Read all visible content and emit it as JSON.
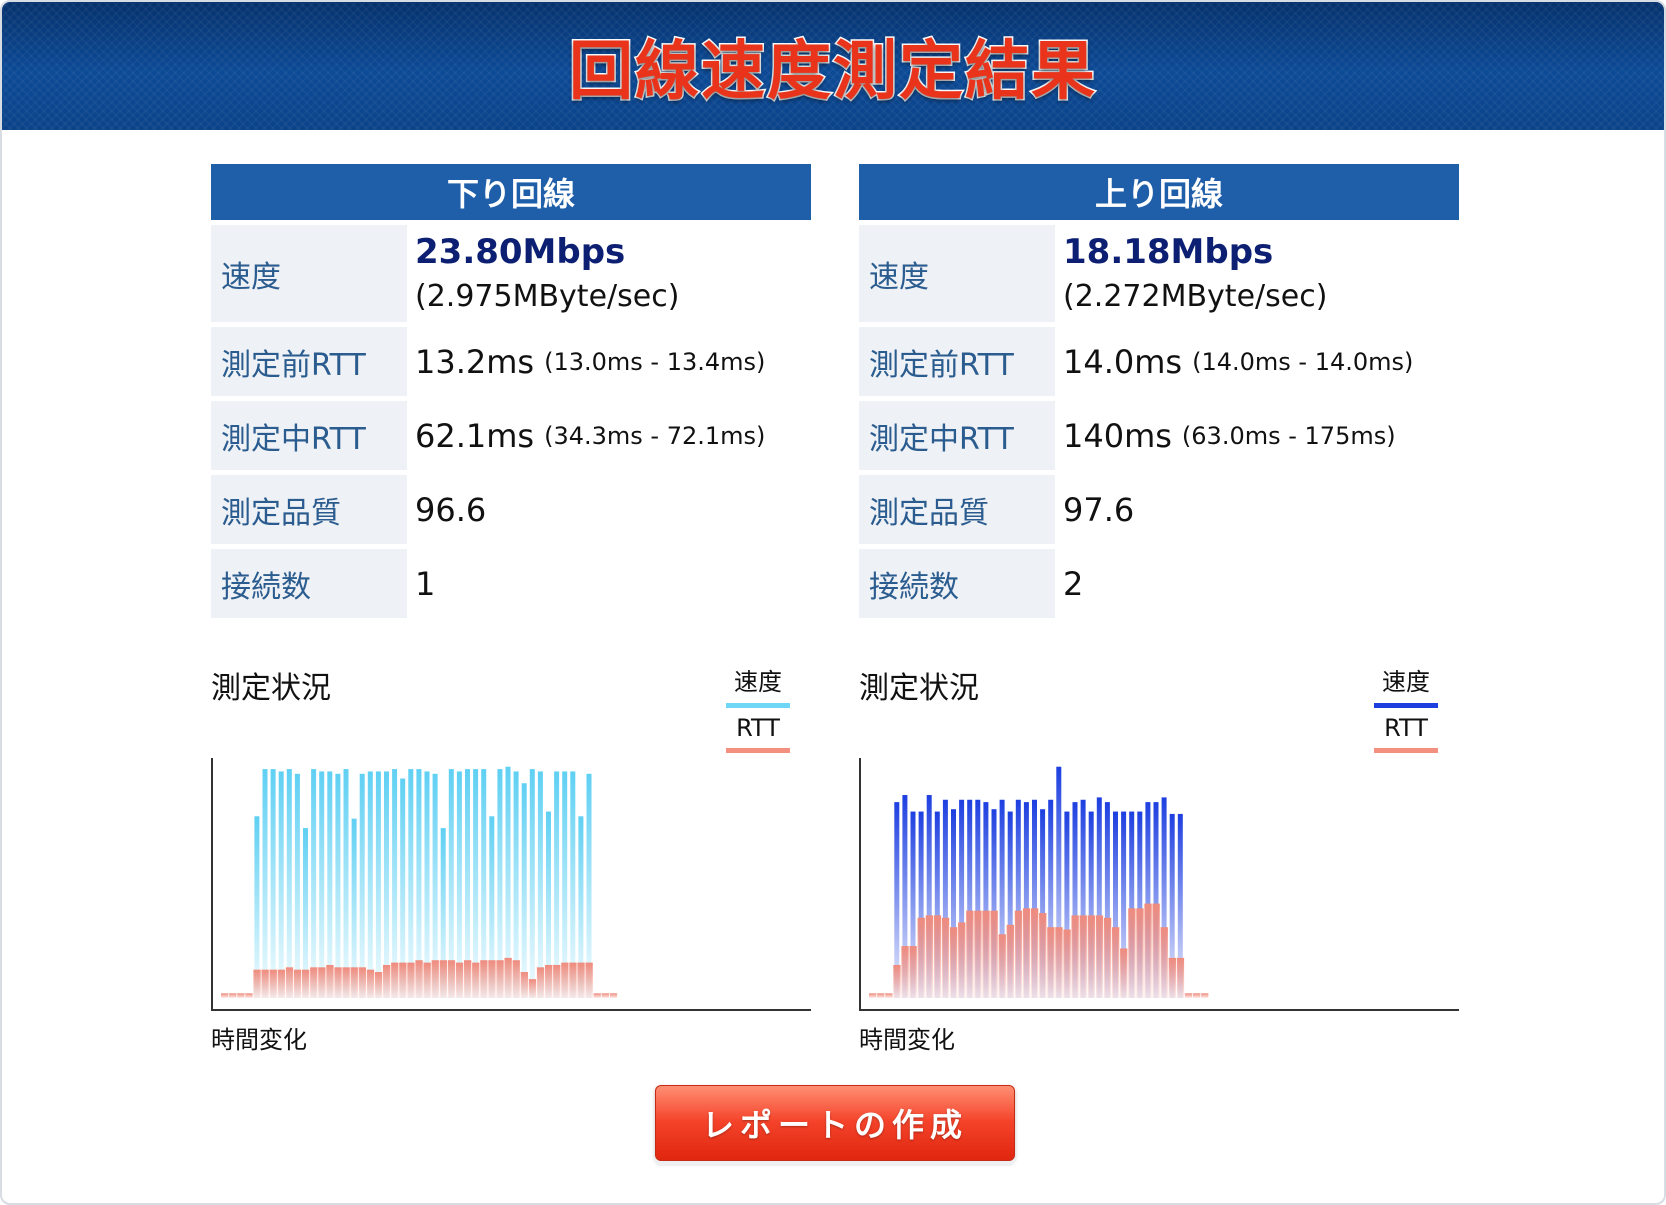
{
  "title": "回線速度測定結果",
  "downlink": {
    "heading": "下り回線",
    "speed_label": "速度",
    "speed_main": "23.80Mbps",
    "speed_sub": "(2.975MByte/sec)",
    "rtt_before_label": "測定前RTT",
    "rtt_before_value": "13.2ms",
    "rtt_before_range": "(13.0ms - 13.4ms)",
    "rtt_during_label": "測定中RTT",
    "rtt_during_value": "62.1ms",
    "rtt_during_range": "(34.3ms - 72.1ms)",
    "quality_label": "測定品質",
    "quality_value": "96.6",
    "connections_label": "接続数",
    "connections_value": "1",
    "status_title": "測定状況",
    "legend_speed": "速度",
    "legend_rtt": "RTT",
    "time_label": "時間変化"
  },
  "uplink": {
    "heading": "上り回線",
    "speed_label": "速度",
    "speed_main": "18.18Mbps",
    "speed_sub": "(2.272MByte/sec)",
    "rtt_before_label": "測定前RTT",
    "rtt_before_value": "14.0ms",
    "rtt_before_range": "(14.0ms - 14.0ms)",
    "rtt_during_label": "測定中RTT",
    "rtt_during_value": "140ms",
    "rtt_during_range": "(63.0ms - 175ms)",
    "quality_label": "測定品質",
    "quality_value": "97.6",
    "connections_label": "接続数",
    "connections_value": "2",
    "status_title": "測定状況",
    "legend_speed": "速度",
    "legend_rtt": "RTT",
    "time_label": "時間変化"
  },
  "report_button": "レポートの作成",
  "colors": {
    "header_bg": "#0c4a96",
    "table_head": "#1f5ea8",
    "label_text": "#2b5c8f",
    "speed_text": "#0c1f72",
    "down_speed_bar": "#5fd0f3",
    "up_speed_bar": "#1d3fe0",
    "rtt_bar": "#f08b7d",
    "button": "#f4432a"
  },
  "chart_data": [
    {
      "type": "bar",
      "title": "測定状況",
      "xlabel": "時間変化",
      "ylabel": "",
      "ylim": [
        0,
        1
      ],
      "series": [
        {
          "name": "速度",
          "color": "#5fd0f3",
          "values": [
            0,
            0,
            0,
            0,
            0.77,
            0.97,
            0.97,
            0.96,
            0.97,
            0.95,
            0.72,
            0.97,
            0.96,
            0.96,
            0.95,
            0.97,
            0.76,
            0.95,
            0.96,
            0.96,
            0.96,
            0.97,
            0.93,
            0.97,
            0.97,
            0.96,
            0.95,
            0.72,
            0.97,
            0.96,
            0.97,
            0.97,
            0.97,
            0.77,
            0.97,
            0.98,
            0.96,
            0.91,
            0.97,
            0.96,
            0.79,
            0.96,
            0.96,
            0.96,
            0.77,
            0.95,
            0,
            0,
            0
          ]
        },
        {
          "name": "RTT",
          "color": "#f08b7d",
          "values": [
            0.02,
            0.02,
            0.02,
            0.02,
            0.12,
            0.12,
            0.12,
            0.12,
            0.13,
            0.12,
            0.12,
            0.13,
            0.13,
            0.14,
            0.13,
            0.13,
            0.13,
            0.13,
            0.12,
            0.11,
            0.14,
            0.15,
            0.15,
            0.15,
            0.16,
            0.15,
            0.16,
            0.16,
            0.16,
            0.15,
            0.16,
            0.15,
            0.16,
            0.16,
            0.16,
            0.17,
            0.16,
            0.11,
            0.08,
            0.13,
            0.14,
            0.14,
            0.15,
            0.15,
            0.15,
            0.15,
            0.02,
            0.02,
            0.02
          ]
        }
      ]
    },
    {
      "type": "bar",
      "title": "測定状況",
      "xlabel": "時間変化",
      "ylabel": "",
      "ylim": [
        0,
        1
      ],
      "series": [
        {
          "name": "速度",
          "color": "#1d3fe0",
          "values": [
            0,
            0,
            0,
            0.83,
            0.86,
            0.79,
            0.79,
            0.86,
            0.79,
            0.84,
            0.8,
            0.84,
            0.84,
            0.84,
            0.83,
            0.8,
            0.84,
            0.79,
            0.84,
            0.83,
            0.84,
            0.8,
            0.84,
            0.98,
            0.79,
            0.83,
            0.84,
            0.79,
            0.85,
            0.83,
            0.79,
            0.79,
            0.79,
            0.79,
            0.83,
            0.83,
            0.85,
            0.78,
            0.78,
            0,
            0,
            0
          ]
        },
        {
          "name": "RTT",
          "color": "#f08b7d",
          "values": [
            0.02,
            0.02,
            0.02,
            0.14,
            0.22,
            0.22,
            0.34,
            0.35,
            0.35,
            0.34,
            0.3,
            0.32,
            0.37,
            0.37,
            0.37,
            0.37,
            0.27,
            0.31,
            0.37,
            0.38,
            0.38,
            0.36,
            0.3,
            0.3,
            0.29,
            0.35,
            0.35,
            0.35,
            0.35,
            0.34,
            0.3,
            0.21,
            0.38,
            0.38,
            0.4,
            0.4,
            0.3,
            0.17,
            0.17,
            0.02,
            0.02,
            0.02
          ]
        }
      ]
    }
  ]
}
